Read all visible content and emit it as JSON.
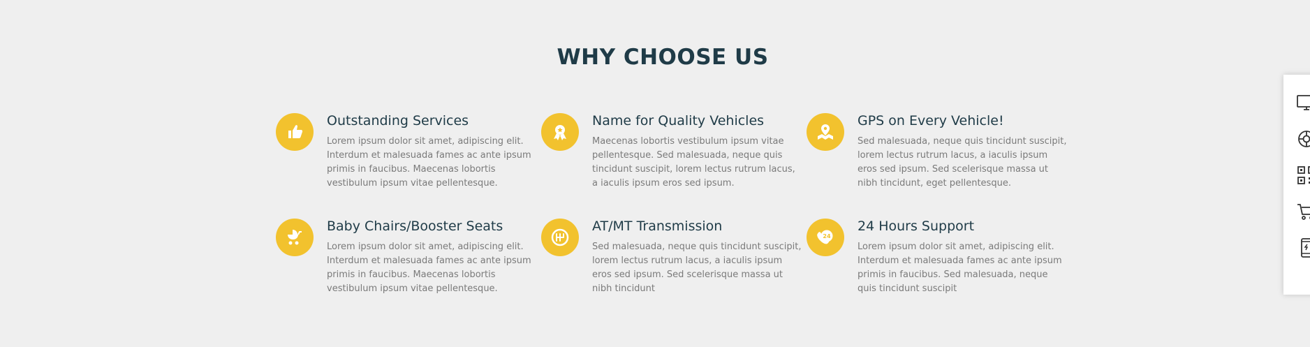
{
  "section": {
    "title": "WHY CHOOSE US"
  },
  "features": [
    {
      "icon": "thumbs-up-icon",
      "title": "Outstanding Services",
      "description": "Lorem ipsum dolor sit amet, adipiscing elit. Interdum et malesuada fames ac ante ipsum primis in faucibus. Maecenas lobortis vestibulum ipsum vitae pellentesque."
    },
    {
      "icon": "award-ribbon-icon",
      "title": "Name for Quality Vehicles",
      "description": "Maecenas lobortis vestibulum ipsum vitae pellentesque. Sed malesuada, neque quis tincidunt suscipit, lorem lectus rutrum lacus, a iaculis ipsum eros sed ipsum."
    },
    {
      "icon": "map-pin-icon",
      "title": "GPS on Every Vehicle!",
      "description": "Sed malesuada, neque quis tincidunt suscipit, lorem lectus rutrum lacus, a iaculis ipsum eros sed ipsum. Sed scelerisque massa ut nibh tincidunt, eget pellentesque."
    },
    {
      "icon": "baby-stroller-icon",
      "title": "Baby Chairs/Booster Seats",
      "description": "Lorem ipsum dolor sit amet, adipiscing elit. Interdum et malesuada fames ac ante ipsum primis in faucibus. Maecenas lobortis vestibulum ipsum vitae pellentesque."
    },
    {
      "icon": "gear-shift-icon",
      "title": "AT/MT Transmission",
      "description": "Sed malesuada, neque quis tincidunt suscipit, lorem lectus rutrum lacus, a iaculis ipsum eros sed ipsum. Sed scelerisque massa ut nibh tincidunt"
    },
    {
      "icon": "phone-24-icon",
      "title": "24 Hours Support",
      "description": "Lorem ipsum dolor sit amet, adipiscing elit. Interdum et malesuada fames ac ante ipsum primis in faucibus. Sed malesuada, neque quis tincidunt suscipit"
    }
  ],
  "icon_badge_text": "24",
  "side_panel": {
    "items": [
      "monitor-icon",
      "lifebuoy-icon",
      "qr-code-icon",
      "shopping-cart-icon",
      "mobile-phone-icon"
    ]
  },
  "colors": {
    "accent": "#f2c22e",
    "heading": "#1f3b47",
    "body_text": "#7a7a7a",
    "background": "#efefef"
  }
}
